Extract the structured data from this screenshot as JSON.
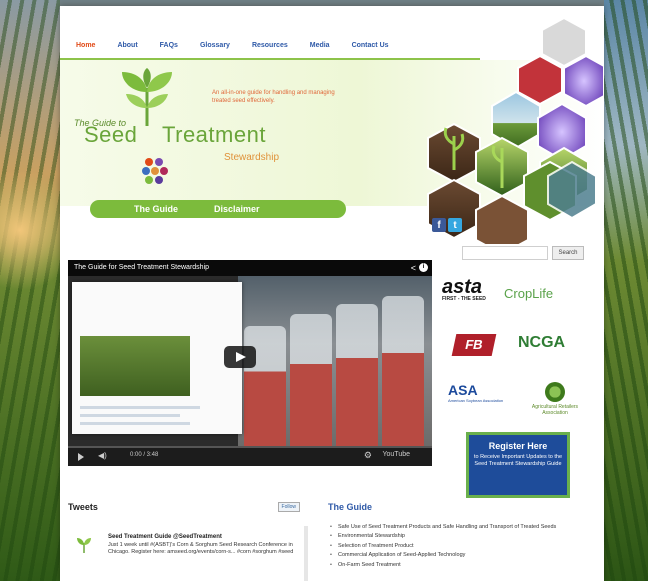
{
  "colors": {
    "nav_text": "#2f5aa8",
    "nav_active": "#e14a17",
    "brand_green": "#7cbb3c",
    "register_blue": "#1e4c9a"
  },
  "nav": {
    "items": [
      "Home",
      "About",
      "FAQs",
      "Glossary",
      "Resources",
      "Media",
      "Contact Us"
    ],
    "active": "Home"
  },
  "header": {
    "logo_line1": "The Guide to",
    "logo_seed": "Seed",
    "logo_treatment": "Treatment",
    "logo_stewardship": "Stewardship",
    "tagline": "An all-in-one guide for handling and managing treated seed effectively.",
    "buttons": [
      "The Guide",
      "Disclaimer"
    ]
  },
  "social": {
    "facebook": "f",
    "twitter": "t"
  },
  "search": {
    "placeholder": "",
    "button": "Search"
  },
  "video": {
    "title": "The Guide for Seed Treatment Stewardship",
    "time": "0:00 / 3:48",
    "yt_label": "YouTube"
  },
  "partners": {
    "asta": "asta",
    "asta_sub": "FIRST - THE SEED",
    "croplife": "CropLife",
    "fb": "FB",
    "ncga": "NCGA",
    "asa": "ASA",
    "asa_sub": "American Soybean Association",
    "agri": "Agricultural Retailers Association"
  },
  "register": {
    "heading": "Register Here",
    "body": "to Receive Important Updates to the Seed Treatment Stewardship Guide"
  },
  "tweets": {
    "heading": "Tweets",
    "follow": "Follow",
    "name": "Seed Treatment Guide @SeedTreatment",
    "text": "Just 1 week until #(ASBT)'s Corn & Sorghum Seed Research Conference in Chicago. Register here: amseed.org/events/corn-s... #corn #sorghum #seed"
  },
  "guide": {
    "heading": "The Guide",
    "items": [
      "Safe Use of Seed Treatment Products and Safe Handling and Transport of Treated Seeds",
      "Environmental Stewardship",
      "Selection of Treatment Product",
      "Commercial Application of Seed-Applied Technology",
      "On-Farm Seed Treatment"
    ]
  }
}
